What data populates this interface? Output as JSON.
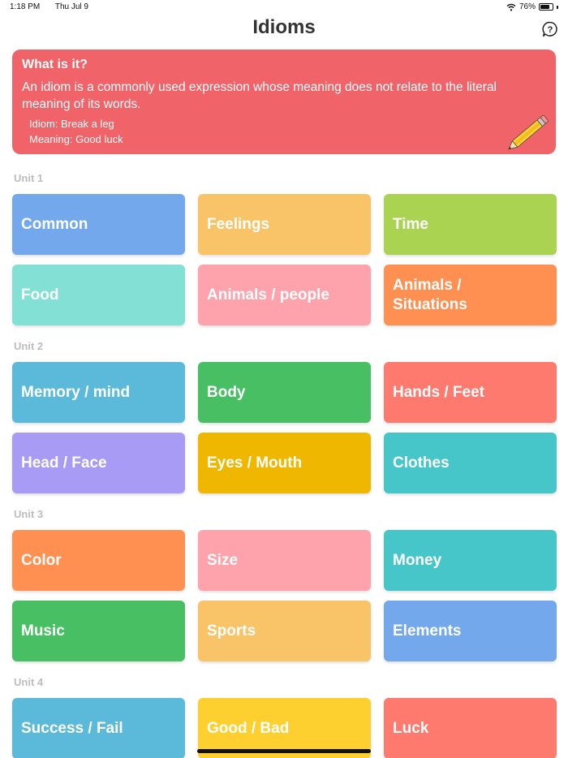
{
  "status": {
    "time": "1:18 PM",
    "date": "Thu Jul 9",
    "battery": "76%",
    "battery_level": 0.76
  },
  "header": {
    "title": "Idioms"
  },
  "info": {
    "title": "What is it?",
    "description": "An idiom is a commonly used expression whose meaning does not relate to the literal meaning of its words.",
    "idiom_example": "Idiom: Break a leg",
    "meaning_example": "Meaning: Good luck"
  },
  "units": [
    {
      "label": "Unit 1",
      "topics": [
        {
          "label": "Common",
          "color": "#73a8ec"
        },
        {
          "label": "Feelings",
          "color": "#f8c467"
        },
        {
          "label": "Time",
          "color": "#a9d351"
        },
        {
          "label": "Food",
          "color": "#82e0d5"
        },
        {
          "label": "Animals / people",
          "color": "#fea3ab"
        },
        {
          "label": "Animals / Situations",
          "color": "#ff9052"
        }
      ]
    },
    {
      "label": "Unit 2",
      "topics": [
        {
          "label": "Memory / mind",
          "color": "#5bb9d9"
        },
        {
          "label": "Body",
          "color": "#47bf62"
        },
        {
          "label": "Hands / Feet",
          "color": "#ff7a6e"
        },
        {
          "label": "Head / Face",
          "color": "#a89bf5"
        },
        {
          "label": "Eyes / Mouth",
          "color": "#efb700"
        },
        {
          "label": "Clothes",
          "color": "#47c6c9"
        }
      ]
    },
    {
      "label": "Unit 3",
      "topics": [
        {
          "label": "Color",
          "color": "#ff9052"
        },
        {
          "label": "Size",
          "color": "#fea3ab"
        },
        {
          "label": "Money",
          "color": "#47c6c9"
        },
        {
          "label": "Music",
          "color": "#47bf62"
        },
        {
          "label": "Sports",
          "color": "#f8c467"
        },
        {
          "label": "Elements",
          "color": "#73a8ec"
        }
      ]
    },
    {
      "label": "Unit 4",
      "topics": [
        {
          "label": "Success / Fail",
          "color": "#5bb9d9"
        },
        {
          "label": "Good / Bad",
          "color": "#fdd02f"
        },
        {
          "label": "Luck",
          "color": "#ff7a6e"
        }
      ]
    }
  ],
  "colors": {
    "info_card": "#f06368",
    "unit_label": "#bdbdbd"
  },
  "icons": {
    "help": "question-bubble-icon",
    "pencil": "pencil-icon",
    "wifi": "wifi-icon",
    "battery": "battery-icon"
  }
}
